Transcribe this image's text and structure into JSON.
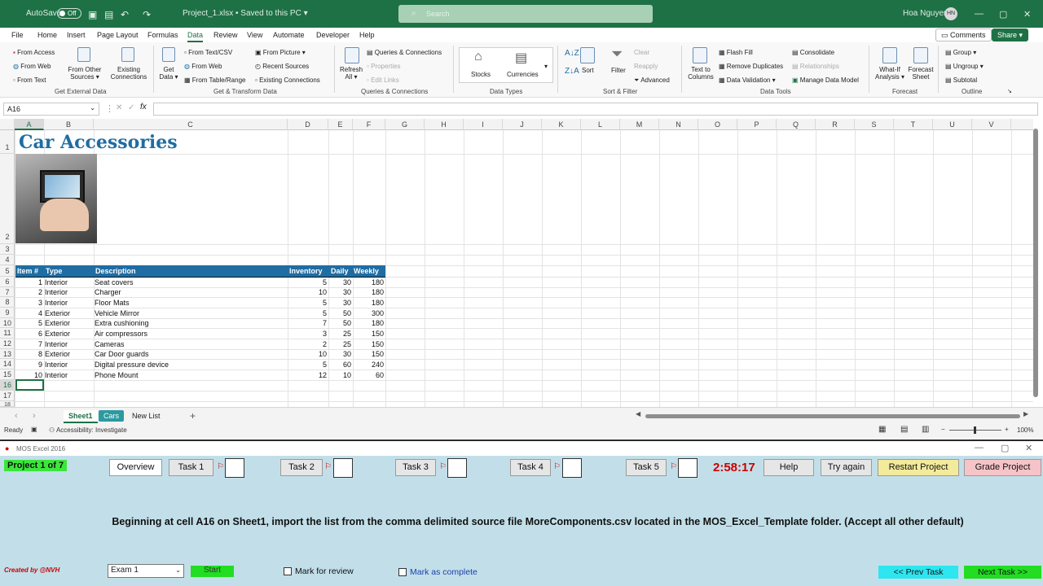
{
  "titlebar": {
    "autosave": "AutoSave",
    "toggle": "Off",
    "doc": "Project_1.xlsx • Saved to this PC ▾",
    "search": "Search",
    "user": "Hoa Nguyen",
    "initials": "HN"
  },
  "menu": [
    "File",
    "Home",
    "Insert",
    "Page Layout",
    "Formulas",
    "Data",
    "Review",
    "View",
    "Automate",
    "Developer",
    "Help"
  ],
  "menu_active": "Data",
  "comments": "Comments",
  "share": "Share",
  "ribbon": {
    "ext": {
      "access": "From Access",
      "web": "From Web",
      "text": "From Text",
      "other": "From Other Sources ▾",
      "existing": "Existing Connections",
      "label": "Get External Data"
    },
    "get": {
      "getdata": "Get Data ▾",
      "csv": "From Text/CSV",
      "web": "From Web",
      "table": "From Table/Range",
      "picture": "From Picture ▾",
      "recent": "Recent Sources",
      "existing": "Existing Connections",
      "label": "Get & Transform Data"
    },
    "queries": {
      "refresh": "Refresh All ▾",
      "qc": "Queries & Connections",
      "props": "Properties",
      "links": "Edit Links",
      "label": "Queries & Connections"
    },
    "types": {
      "stocks": "Stocks",
      "currencies": "Currencies",
      "label": "Data Types"
    },
    "sort": {
      "sort": "Sort",
      "filter": "Filter",
      "clear": "Clear",
      "reapply": "Reapply",
      "advanced": "Advanced",
      "label": "Sort & Filter"
    },
    "tools": {
      "ttc": "Text to Columns",
      "flash": "Flash Fill",
      "remove": "Remove Duplicates",
      "validation": "Data Validation ▾",
      "consolidate": "Consolidate",
      "relationships": "Relationships",
      "model": "Manage Data Model",
      "label": "Data Tools"
    },
    "forecast": {
      "whatif": "What-If Analysis ▾",
      "sheet": "Forecast Sheet",
      "label": "Forecast"
    },
    "outline": {
      "group": "Group ▾",
      "ungroup": "Ungroup ▾",
      "subtotal": "Subtotal",
      "label": "Outline"
    }
  },
  "namebox": "A16",
  "columns": [
    "A",
    "B",
    "C",
    "D",
    "E",
    "F",
    "G",
    "H",
    "I",
    "J",
    "K",
    "L",
    "M",
    "N",
    "O",
    "P",
    "Q",
    "R",
    "S",
    "T",
    "U",
    "V"
  ],
  "rows": [
    "1",
    "2",
    "3",
    "4",
    "5",
    "6",
    "7",
    "8",
    "9",
    "10",
    "11",
    "12",
    "13",
    "14",
    "15",
    "16",
    "17",
    "18"
  ],
  "sheet": {
    "title": "Car Accessories",
    "headers": [
      "Item #",
      "Type",
      "Description",
      "Inventory",
      "Daily",
      "Weekly"
    ],
    "data": [
      [
        "1",
        "Interior",
        "Seat covers",
        "5",
        "30",
        "180"
      ],
      [
        "2",
        "Interior",
        "Charger",
        "10",
        "30",
        "180"
      ],
      [
        "3",
        "Interior",
        "Floor Mats",
        "5",
        "30",
        "180"
      ],
      [
        "4",
        "Exterior",
        "Vehicle Mirror",
        "5",
        "50",
        "300"
      ],
      [
        "5",
        "Exterior",
        "Extra cushioning",
        "7",
        "50",
        "180"
      ],
      [
        "6",
        "Exterior",
        "Air compressors",
        "3",
        "25",
        "150"
      ],
      [
        "7",
        "Interior",
        "Cameras",
        "2",
        "25",
        "150"
      ],
      [
        "8",
        "Exterior",
        "Car Door guards",
        "10",
        "30",
        "150"
      ],
      [
        "9",
        "Interior",
        "Digital pressure device",
        "5",
        "60",
        "240"
      ],
      [
        "10",
        "Interior",
        "Phone Mount",
        "12",
        "10",
        "60"
      ]
    ]
  },
  "tabs": [
    "Sheet1",
    "Cars",
    "New List"
  ],
  "status": {
    "ready": "Ready",
    "access": "Accessibility: Investigate",
    "zoom": "100%"
  },
  "mos": {
    "window": "MOS Excel 2016",
    "project": "Project 1 of 7",
    "overview": "Overview",
    "tasks": [
      "Task 1",
      "Task 2",
      "Task 3",
      "Task 4",
      "Task 5"
    ],
    "timer": "2:58:17",
    "help": "Help",
    "retry": "Try again",
    "restart": "Restart Project",
    "grade": "Grade Project",
    "instruction": "Beginning at cell A16 on Sheet1, import the list from the comma delimited source file MoreComponents.csv located in the MOS_Excel_Template folder. (Accept all other default)",
    "credit": "Created by @NVH",
    "exam": "Exam 1",
    "start": "Start",
    "review": "Mark for review",
    "complete": "Mark as complete",
    "prev": "<< Prev Task",
    "next": "Next Task >>",
    "colors": {
      "timer": "#cc0000",
      "panel": "#c2dfe9",
      "restart": "#f3eb9c",
      "grade": "#f6c4c8",
      "prev": "#2ee6f0",
      "next": "#22dd22"
    }
  }
}
